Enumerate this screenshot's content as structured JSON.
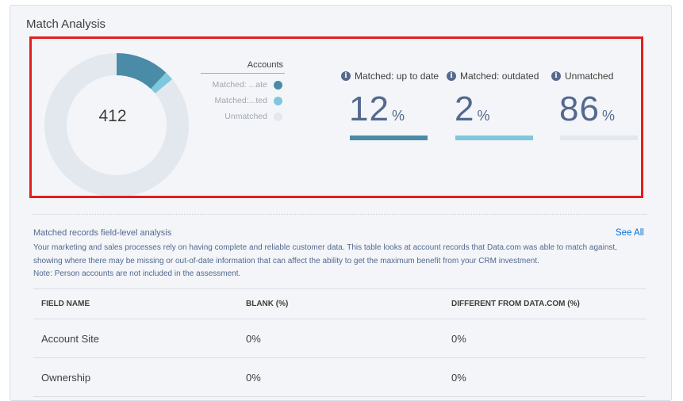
{
  "card": {
    "title": "Match Analysis"
  },
  "donut": {
    "total": "412",
    "colors": {
      "matched_up_to_date": "#4a8ba8",
      "matched_outdated": "#7ec7dc",
      "unmatched": "#e3e8ef"
    }
  },
  "legend": {
    "title": "Accounts",
    "items": [
      {
        "label": "Matched: ...ate",
        "color": "#4a8ba8"
      },
      {
        "label": "Matched:...ted",
        "color": "#7ec7dc"
      },
      {
        "label": "Unmatched",
        "color": "#e3e8ef"
      }
    ]
  },
  "stats": [
    {
      "label": "Matched: up to date",
      "value": "12",
      "unit": "%",
      "fraction": 0.12,
      "bar_color": "#4a8ba8",
      "icon": "info-icon"
    },
    {
      "label": "Matched: outdated",
      "value": "2",
      "unit": "%",
      "fraction": 0.02,
      "bar_color": "#7ec7dc",
      "icon": "info-icon"
    },
    {
      "label": "Unmatched",
      "value": "86",
      "unit": "%",
      "fraction": 0.86,
      "bar_color": "#e3e8ef",
      "icon": "info-icon"
    }
  ],
  "analysis": {
    "title": "Matched records field-level analysis",
    "see_all": "See All",
    "description": "Your marketing and sales processes rely on having complete and reliable customer data. This table looks at account records that Data.com was able to match against, showing where there may be missing or out-of-date information that can affect the ability to get the maximum benefit from your CRM investment.",
    "note": "Note: Person accounts are not included in the assessment."
  },
  "table": {
    "headers": [
      "FIELD NAME",
      "BLANK (%)",
      "DIFFERENT FROM DATA.COM (%)"
    ],
    "rows": [
      [
        "Account Site",
        "0%",
        "0%"
      ],
      [
        "Ownership",
        "0%",
        "0%"
      ]
    ]
  }
}
